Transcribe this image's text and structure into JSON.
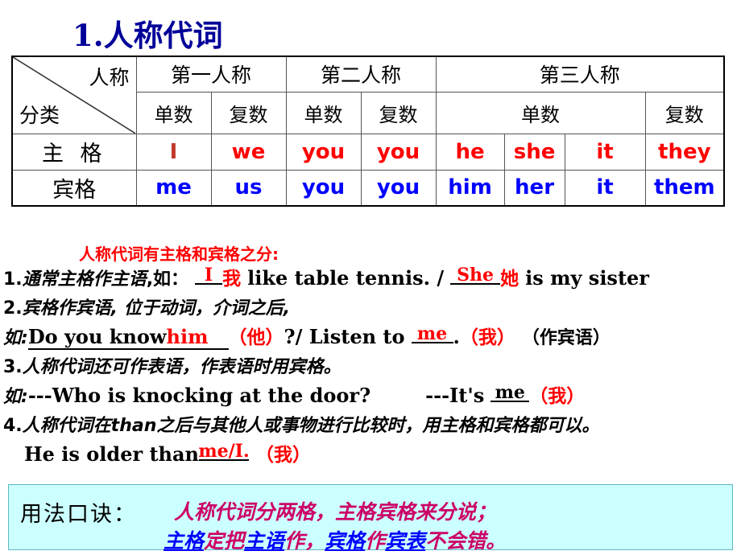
{
  "title": "1.人称代词",
  "table": {
    "corner": {
      "top_label": "人称",
      "bottom_label": "分类"
    },
    "person_headers": [
      "第一人称",
      "第二人称",
      "第三人称"
    ],
    "number_headers": {
      "first_singular": "单数",
      "first_plural": "复数",
      "second_singular": "单数",
      "second_plural": "复数",
      "third_singular": "单数",
      "third_plural": "复数"
    },
    "rows": [
      {
        "label": "主 格",
        "cells": [
          "I",
          "we",
          "you",
          "you",
          "he",
          "she",
          "it",
          "they"
        ]
      },
      {
        "label": "宾格",
        "cells": [
          "me",
          "us",
          "you",
          "you",
          "him",
          "her",
          "it",
          "them"
        ]
      }
    ]
  },
  "notes": {
    "heading": "人称代词有主格和宾格之分:",
    "line1": {
      "num": "1.",
      "cn": "通常主格作主语",
      "cn_tail": ",如：",
      "answer1": "I",
      "gloss1": "我",
      "en1": "like table tennis. /",
      "answer2": "She",
      "gloss2": "她",
      "en2": "is my sister"
    },
    "line2": {
      "num": "2.",
      "cn": "宾格作宾语, 位于动词，介词之后,",
      "lead": "如:",
      "en1": "Do you know",
      "answer1": "him",
      "gloss1": "（他）",
      "en2": "?/ Listen to",
      "answer2": "me",
      "gloss2": "（我）",
      "gloss3": "（作宾语）"
    },
    "line3": {
      "num": "3.",
      "cn": "人称代词还可作表语，作表语时用宾格。",
      "lead": "如:",
      "en1": "---Who is knocking at the door?",
      "en2": "---It's",
      "answer": "me",
      "gloss": "（我）"
    },
    "line4": {
      "num": "4.",
      "cn": "人称代词在than之后与其他人或事物进行比较时，用主格和宾格都可以。",
      "en": "He is older than",
      "answer": "me/I.",
      "gloss": "（我）"
    }
  },
  "mnemonic": {
    "label": "用法口诀：",
    "line1": "人称代词分两格，主格宾格来分说；",
    "line2_parts": [
      {
        "text": "主格",
        "highlight": true
      },
      {
        "text": "定把",
        "highlight": false
      },
      {
        "text": "主语",
        "highlight": true
      },
      {
        "text": "作，",
        "highlight": false
      },
      {
        "text": "宾格",
        "highlight": true
      },
      {
        "text": "作",
        "highlight": false
      },
      {
        "text": "宾表",
        "highlight": true
      },
      {
        "text": "不会错。",
        "highlight": false
      }
    ]
  },
  "colors": {
    "title": "#000099",
    "subjective": "#ff0000",
    "objective": "#0000ff",
    "note_heading": "#ff0000",
    "mnemonic_bg": "#ccffff",
    "mnemonic_text": "#cc0066",
    "mnemonic_highlight": "#0000ff"
  }
}
